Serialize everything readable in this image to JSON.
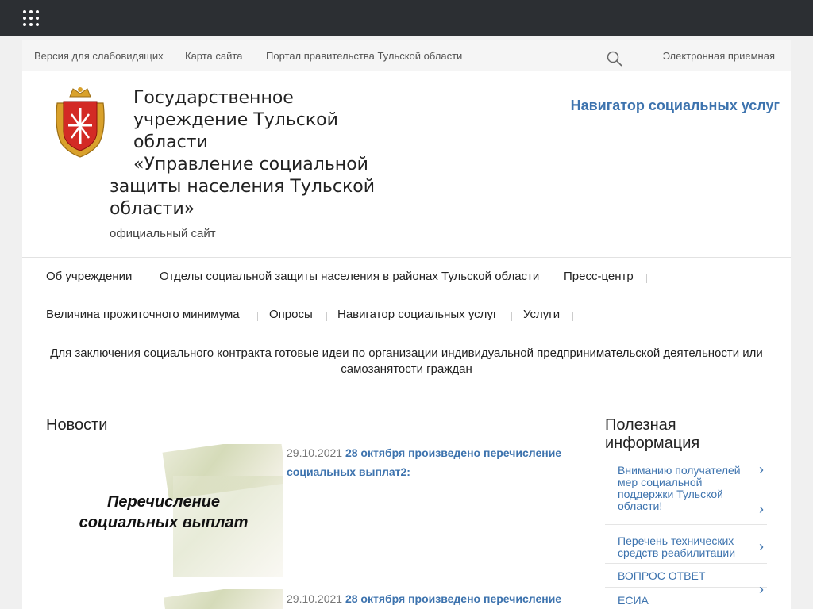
{
  "topbar": {
    "apps_icon": "apps-grid-icon"
  },
  "util": {
    "links": [
      "Версия для слабовидящих",
      "Карта сайта",
      "Портал правительства Тульской области"
    ],
    "search_icon": "search-icon",
    "reception": "Электронная приемная"
  },
  "header": {
    "emblem": "tula-coat-of-arms",
    "title_lines": [
      "Государственное",
      "учреждение Тульской",
      "области",
      "«Управление социальной",
      "защиты населения Тульской",
      "области»"
    ],
    "subtitle": "официальный сайт",
    "navigator_link": "Навигатор социальных услуг"
  },
  "menu": {
    "row1": [
      "Об учреждении",
      "Отделы социальной защиты населения в районах Тульской области",
      "Пресс-центр"
    ],
    "row2": [
      "Величина прожиточного минимума",
      "Опросы",
      "Навигатор социальных услуг",
      "Услуги"
    ],
    "long_item": "Для заключения социального контракта готовые идеи по организации индивидуальной предпринимательской деятельности или самозанятости граждан"
  },
  "news": {
    "heading": "Новости",
    "items": [
      {
        "date": "29.10.2021",
        "title": "28 октября произведено перечисление социальных выплат2:",
        "image_caption": "Перечисление  социальных выплат"
      },
      {
        "date": "29.10.2021",
        "title": "28 октября произведено перечисление",
        "image_caption": ""
      }
    ]
  },
  "sidebar": {
    "heading": "Полезная информация",
    "items": [
      "Вниманию получателей мер социальной поддержки Тульской области!",
      "Перечень технических средств реабилитации",
      "ВОПРОС ОТВЕТ",
      "ЕСИА"
    ],
    "chevron_icon": "chevron-right-icon"
  }
}
